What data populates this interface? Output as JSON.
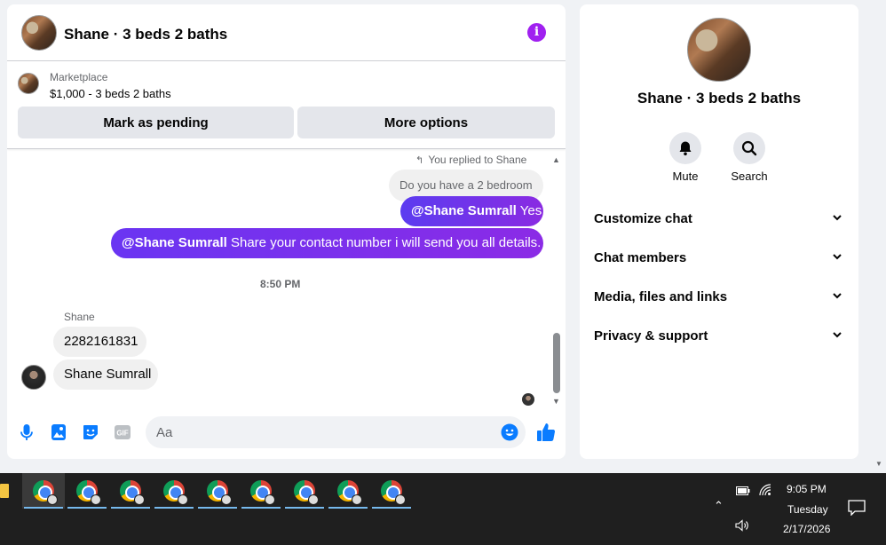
{
  "chat": {
    "header_title": "Shane · 3 beds 2 baths",
    "info_icon": "i",
    "marketplace": {
      "label": "Marketplace",
      "price_line": "$1,000 - 3 beds 2 baths",
      "mark_pending": "Mark as pending",
      "more_options": "More options"
    },
    "messages": {
      "replied_note": "You replied to Shane",
      "quoted": "Do you have a 2 bedroom",
      "reply_mention": "@Shane Sumrall",
      "reply_text": " Yes",
      "share_mention": "@Shane Sumrall",
      "share_text": " Share your contact number i will send you all details.",
      "timestamp": "8:50 PM",
      "sender_name": "Shane",
      "incoming_1": "2282161831",
      "incoming_2": "Shane Sumrall"
    },
    "composer": {
      "placeholder": "Aa"
    }
  },
  "info_panel": {
    "title": "Shane · 3 beds 2 baths",
    "actions": {
      "mute": "Mute",
      "search": "Search"
    },
    "sections": {
      "customize": "Customize chat",
      "members": "Chat members",
      "media": "Media, files and links",
      "privacy": "Privacy & support"
    }
  },
  "taskbar": {
    "time": "9:05 PM",
    "day": "Tuesday",
    "date": "2/17/2026",
    "apps": [
      "chrome-icon",
      "chrome-icon",
      "chrome-icon",
      "chrome-icon",
      "chrome-icon",
      "chrome-icon",
      "chrome-icon",
      "chrome-icon",
      "chrome-icon"
    ]
  },
  "colors": {
    "accent_purple": "#8a2be2",
    "messenger_blue": "#0a7cff",
    "info_icon": "#a020f0",
    "taskbar": "#1f1f1f"
  }
}
